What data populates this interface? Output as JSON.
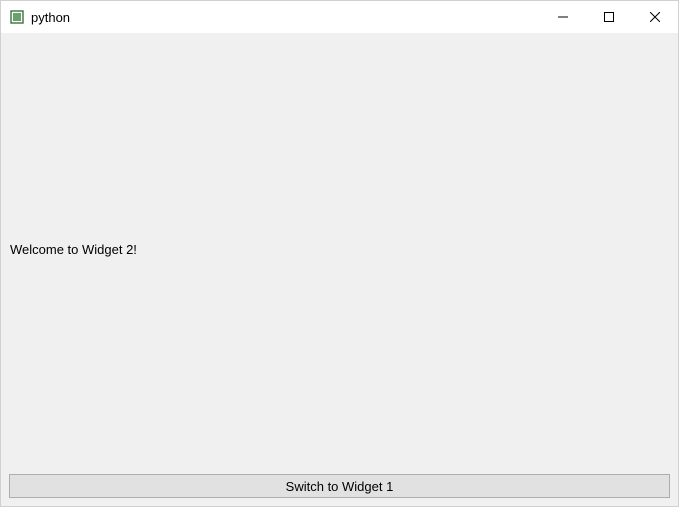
{
  "window": {
    "title": "python"
  },
  "content": {
    "welcome_text": "Welcome to Widget 2!"
  },
  "actions": {
    "switch_button_label": "Switch to Widget 1"
  }
}
